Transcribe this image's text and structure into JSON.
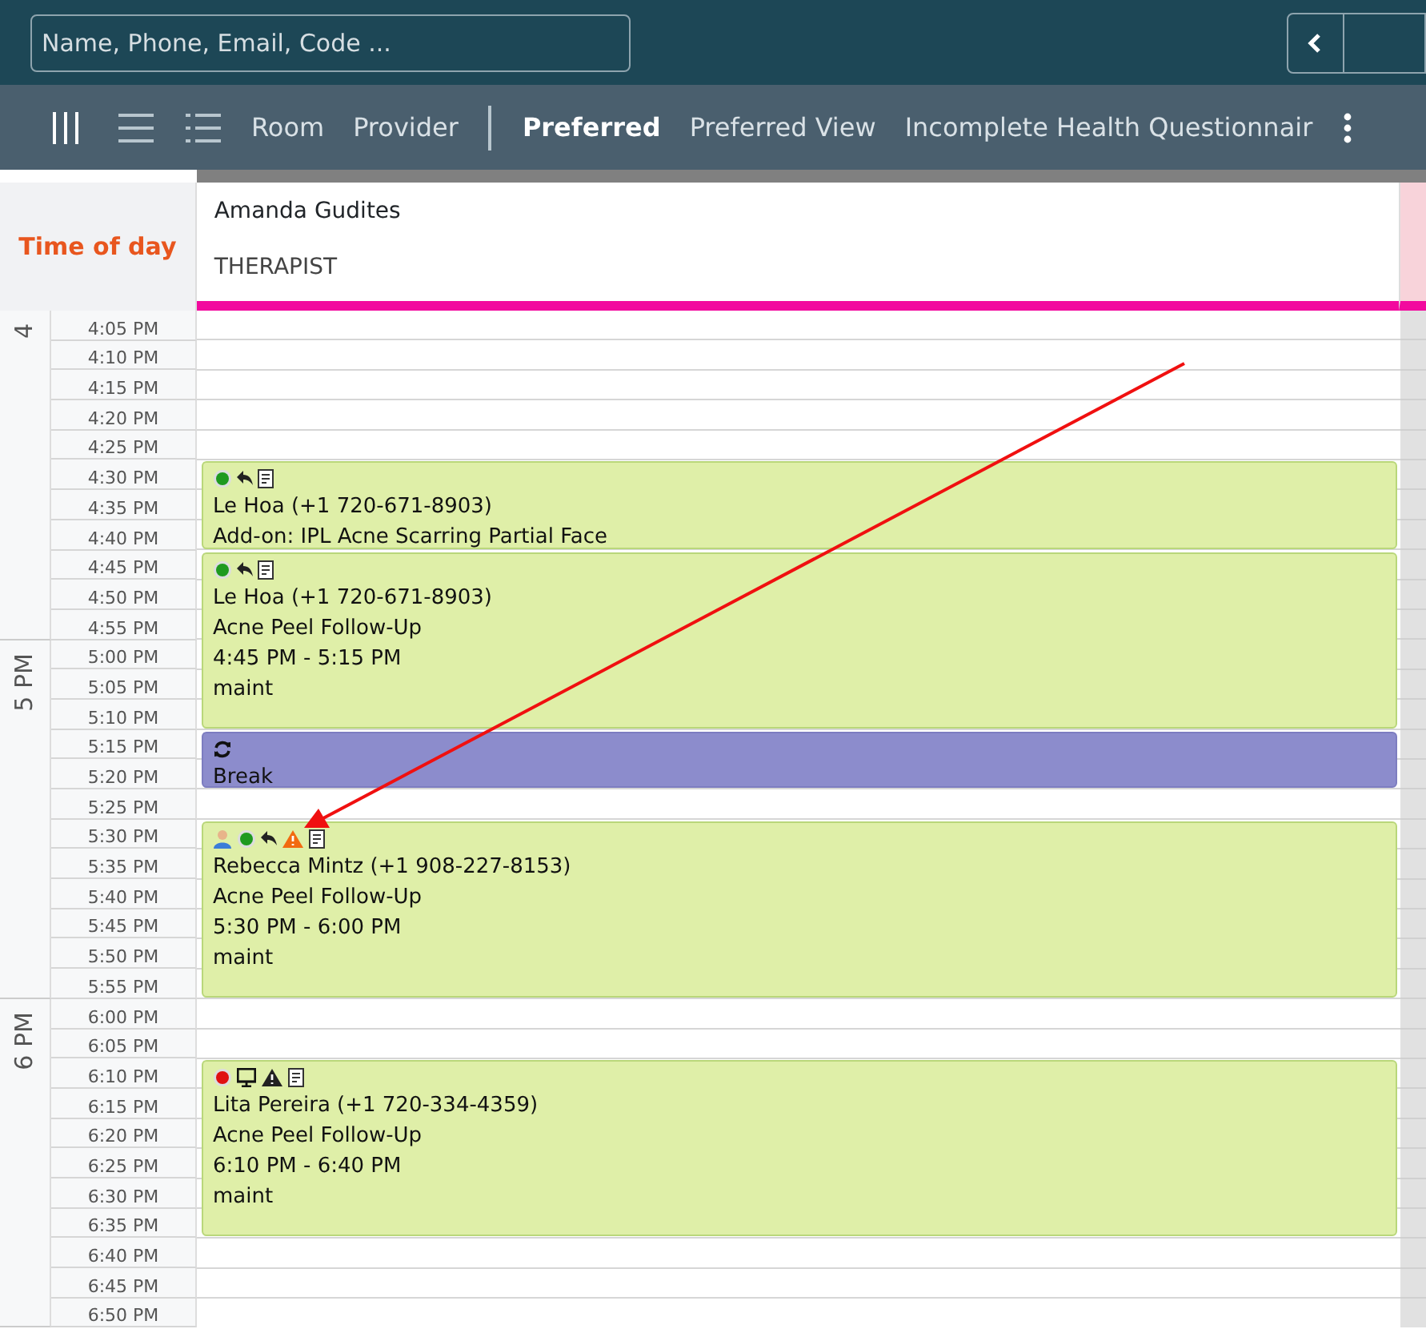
{
  "search": {
    "placeholder": "Name, Phone, Email, Code ..."
  },
  "nav_buttons": [
    {
      "kind": "prev"
    },
    {
      "kind": "blank"
    }
  ],
  "view_buttons": [
    {
      "kind": "columns",
      "selected": true
    },
    {
      "kind": "rows",
      "selected": false
    },
    {
      "kind": "list",
      "selected": false
    }
  ],
  "filters": [
    {
      "label": "Room",
      "selected": false
    },
    {
      "label": "Provider",
      "selected": false
    },
    {
      "label": "Preferred",
      "selected": true
    },
    {
      "label": "Preferred View",
      "selected": false
    },
    {
      "label": "Incomplete Health Questionnair",
      "selected": false
    }
  ],
  "time_header": "Time of day",
  "providers": [
    {
      "name": "Amanda Gudites",
      "role": "THERAPIST"
    }
  ],
  "hours": [
    "4",
    "5 PM",
    "6 PM"
  ],
  "slots": [
    "4:05 PM",
    "4:10 PM",
    "4:15 PM",
    "4:20 PM",
    "4:25 PM",
    "4:30 PM",
    "4:35 PM",
    "4:40 PM",
    "4:45 PM",
    "4:50 PM",
    "4:55 PM",
    "5:00 PM",
    "5:05 PM",
    "5:10 PM",
    "5:15 PM",
    "5:20 PM",
    "5:25 PM",
    "5:30 PM",
    "5:35 PM",
    "5:40 PM",
    "5:45 PM",
    "5:50 PM",
    "5:55 PM",
    "6:00 PM",
    "6:05 PM",
    "6:10 PM",
    "6:15 PM",
    "6:20 PM",
    "6:25 PM",
    "6:30 PM",
    "6:35 PM",
    "6:40 PM",
    "6:45 PM",
    "6:50 PM"
  ],
  "appointments": [
    {
      "kind": "appointment",
      "icons": [
        {
          "kind": "status",
          "color": "#1f9a1f"
        },
        {
          "kind": "reply"
        },
        {
          "kind": "note"
        }
      ],
      "lines": [
        "Le Hoa (+1 720-671-8903)",
        "Add-on: IPL Acne Scarring Partial Face"
      ]
    },
    {
      "kind": "appointment",
      "icons": [
        {
          "kind": "status",
          "color": "#1f9a1f"
        },
        {
          "kind": "reply"
        },
        {
          "kind": "note"
        }
      ],
      "lines": [
        "Le Hoa (+1 720-671-8903)",
        "Acne Peel Follow-Up",
        "4:45 PM - 5:15 PM",
        "maint"
      ]
    },
    {
      "kind": "break",
      "icons": [
        {
          "kind": "repeat"
        }
      ],
      "lines": [
        "Break"
      ]
    },
    {
      "kind": "appointment",
      "icons": [
        {
          "kind": "person"
        },
        {
          "kind": "status",
          "color": "#1f9a1f"
        },
        {
          "kind": "reply"
        },
        {
          "kind": "warning",
          "color": "#f26a10"
        },
        {
          "kind": "note"
        }
      ],
      "lines": [
        "Rebecca Mintz (+1 908-227-8153)",
        "Acne Peel Follow-Up",
        "5:30 PM - 6:00 PM",
        "maint"
      ]
    },
    {
      "kind": "appointment",
      "icons": [
        {
          "kind": "status",
          "color": "#e01010"
        },
        {
          "kind": "monitor"
        },
        {
          "kind": "warning",
          "color": "#222222"
        },
        {
          "kind": "note"
        }
      ],
      "lines": [
        "Lita Pereira (+1 720-334-4359)",
        "Acne Peel Follow-Up",
        "6:10 PM - 6:40 PM",
        "maint"
      ]
    }
  ],
  "annotation": {
    "kind": "arrow"
  }
}
